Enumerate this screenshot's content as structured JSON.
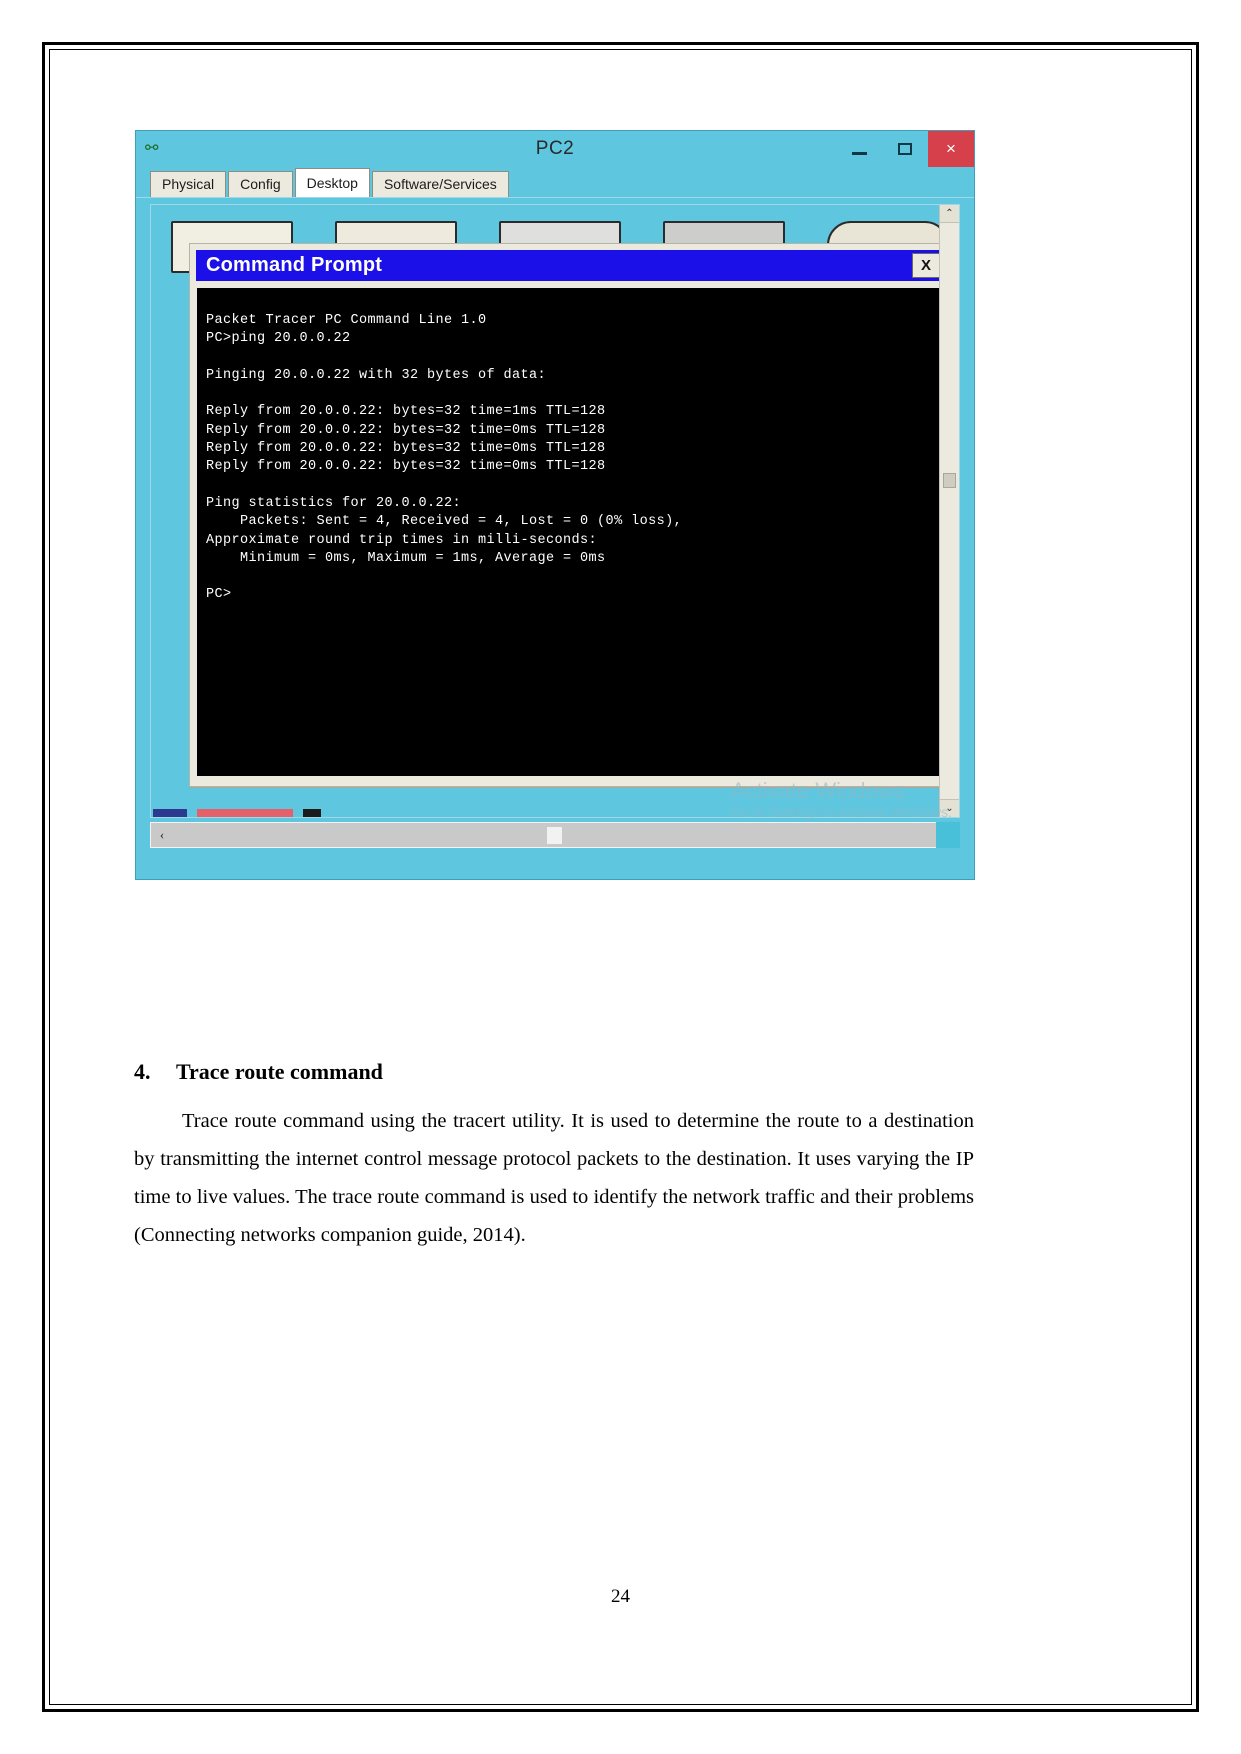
{
  "window": {
    "title": "PC2",
    "app_icon": "packet-tracer-icon",
    "controls": {
      "minimize": "–",
      "maximize": "☐",
      "close": "×"
    },
    "tabs": [
      {
        "label": "Physical",
        "active": false
      },
      {
        "label": "Config",
        "active": false
      },
      {
        "label": "Desktop",
        "active": true
      },
      {
        "label": "Software/Services",
        "active": false
      }
    ]
  },
  "command_prompt": {
    "title": "Command Prompt",
    "close_label": "X",
    "console_text": "Packet Tracer PC Command Line 1.0\nPC>ping 20.0.0.22\n\nPinging 20.0.0.22 with 32 bytes of data:\n\nReply from 20.0.0.22: bytes=32 time=1ms TTL=128\nReply from 20.0.0.22: bytes=32 time=0ms TTL=128\nReply from 20.0.0.22: bytes=32 time=0ms TTL=128\nReply from 20.0.0.22: bytes=32 time=0ms TTL=128\n\nPing statistics for 20.0.0.22:\n    Packets: Sent = 4, Received = 4, Lost = 0 (0% loss),\nApproximate round trip times in milli-seconds:\n    Minimum = 0ms, Maximum = 1ms, Average = 0ms\n\nPC>"
  },
  "scrollbars": {
    "vertical_up": "⌃",
    "vertical_down": "⌄",
    "horizontal_left": "‹",
    "horizontal_right": "›"
  },
  "watermark": {
    "line1": "Activate Windows",
    "line2": "Go to Settings to activate Windows."
  },
  "document": {
    "heading_number": "4.",
    "heading_text": "Trace route command",
    "paragraph": "Trace route command using the tracert utility. It is used to determine the route to a destination by transmitting the internet control message protocol packets to the destination. It uses varying the IP time to live values. The trace route command is used to identify the network traffic and their problems (Connecting networks companion guide, 2014).",
    "page_number": "24"
  },
  "colors": {
    "window_chrome": "#5ec6de",
    "close_button": "#d6404a",
    "cmd_titlebar": "#1b10e8",
    "console_bg": "#000000"
  }
}
